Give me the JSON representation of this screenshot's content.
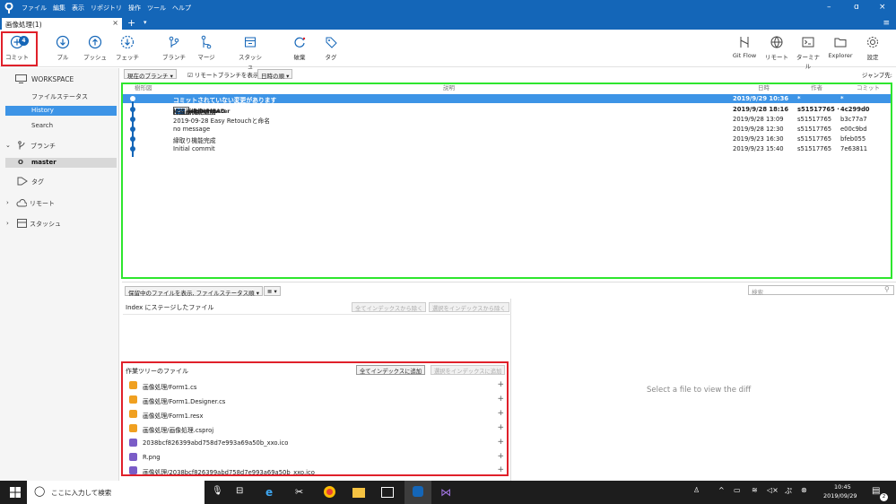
{
  "menu": [
    "ファイル",
    "編集",
    "表示",
    "リポジトリ",
    "操作",
    "ツール",
    "ヘルプ"
  ],
  "window_controls": {
    "minimize": "–",
    "maximize": "ɑ",
    "close": "×"
  },
  "tab": {
    "label": "画像処理(1)",
    "close": "×",
    "add": "+",
    "dropdown": "▾"
  },
  "hamburger": "≡",
  "toolbar": {
    "commit": "コミット",
    "commit_badge": "4",
    "pull": "プル",
    "push": "プッシュ",
    "fetch": "フェッチ",
    "branch": "ブランチ",
    "merge": "マージ",
    "stash": "スタッシュ",
    "discard": "破棄",
    "tag": "タグ",
    "gitflow": "Git Flow",
    "remote": "リモート",
    "terminal": "ターミナル",
    "explorer": "Explorer",
    "settings": "設定"
  },
  "sidebar": {
    "workspace": "WORKSPACE",
    "file_status": "ファイルステータス",
    "history": "History",
    "search": "Search",
    "branches": "ブランチ",
    "branch_master": "master",
    "tags": "タグ",
    "remotes": "リモート",
    "stashes": "スタッシュ"
  },
  "filter": {
    "branch_select": "現在のブランチ ▾",
    "show_remote": "リモートブランチを表示",
    "order": "日時の順 ▾",
    "jump": "ジャンプ先:"
  },
  "history_header": {
    "graph": "樹形図",
    "description": "説明",
    "date": "日時",
    "author": "作者",
    "commit": "コミット"
  },
  "commits": [
    {
      "desc": "コミットされていない変更があります",
      "date": "2019/9/29 10:36",
      "author": "*",
      "hash": "*"
    },
    {
      "refs": [
        "master",
        "origin/master",
        "origin/HEAD"
      ],
      "desc": "枠描画機能追加",
      "date": "2019/9/28 18:16",
      "author": "s51517765 ·",
      "hash": "4c299d0"
    },
    {
      "desc": "2019-09-28 Easy Retouchと命名",
      "date": "2019/9/28 13:09",
      "author": "s51517765",
      "hash": "b3c77a7"
    },
    {
      "desc": "no message",
      "date": "2019/9/28 12:30",
      "author": "s51517765",
      "hash": "e00c9bd"
    },
    {
      "desc": "縁取り機能完成",
      "date": "2019/9/23 16:30",
      "author": "s51517765",
      "hash": "bfeb055"
    },
    {
      "desc": "Initial commit",
      "date": "2019/9/23 15:40",
      "author": "s51517765",
      "hash": "7e63811"
    }
  ],
  "lower": {
    "file_filter": "保留中のファイルを表示, ファイルステータス順 ▾",
    "view_toggle": "≣ ▾",
    "search_placeholder": "検索",
    "staged_title": "Index にステージしたファイル",
    "unstage_all": "全てインデックスから除く",
    "unstage_sel": "選択をインデックスから除く",
    "unstaged_title": "作業ツリーのファイル",
    "stage_all": "全てインデックスに追加",
    "stage_sel": "選択をインデックスに追加",
    "diff_placeholder": "Select a file to view the diff"
  },
  "files": [
    {
      "name": "画像処理/Form1.cs",
      "status": "modified",
      "color": "#f0a020"
    },
    {
      "name": "画像処理/Form1.Designer.cs",
      "status": "modified",
      "color": "#f0a020"
    },
    {
      "name": "画像処理/Form1.resx",
      "status": "modified",
      "color": "#f0a020"
    },
    {
      "name": "画像処理/画像処理.csproj",
      "status": "modified",
      "color": "#f0a020"
    },
    {
      "name": "2038bcf826399abd758d7e993a69a50b_xxo.ico",
      "status": "untracked",
      "color": "#7a5cc7"
    },
    {
      "name": "R.png",
      "status": "untracked",
      "color": "#7a5cc7"
    },
    {
      "name": "画像処理/2038bcf826399abd758d7e993a69a50b_xxo.ico",
      "status": "untracked",
      "color": "#7a5cc7"
    }
  ],
  "taskbar": {
    "search": "ここに入力して検索",
    "time": "10:45",
    "date": "2019/09/29",
    "notif": "2"
  },
  "colors": {
    "accent": "#1466b8",
    "selection": "#3d94e6",
    "highlight_red": "#e0202a",
    "highlight_green": "#2ee62e"
  }
}
